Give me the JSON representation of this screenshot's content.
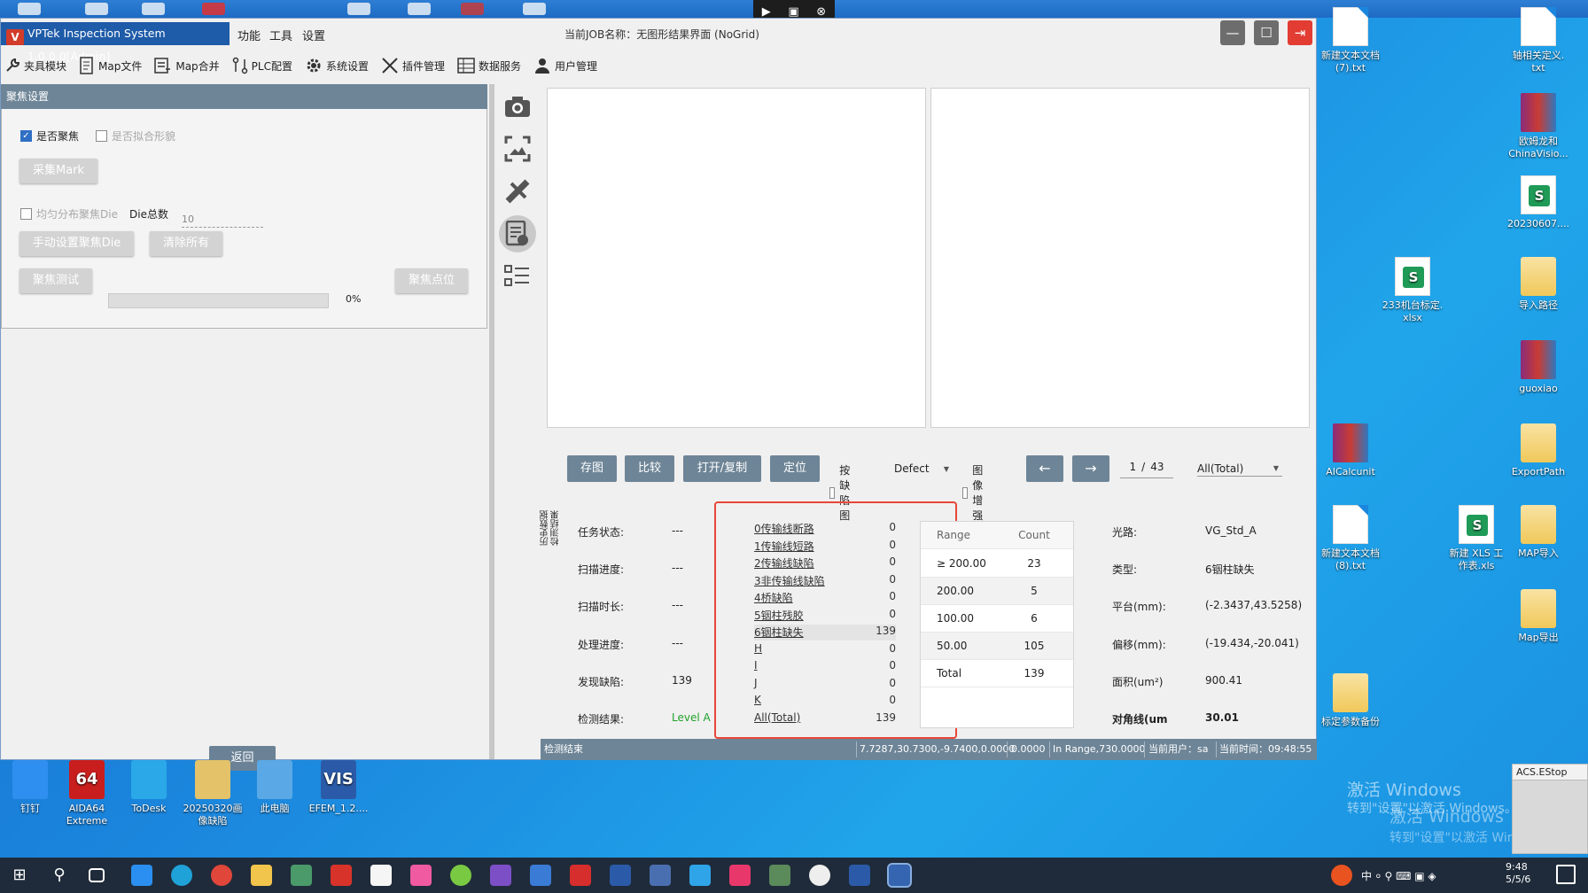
{
  "app": {
    "title": "VPTek Inspection System 1.0.0.0[Admin]",
    "logo_text": "V",
    "menus": [
      "功能",
      "工具",
      "设置"
    ],
    "job_name": "当前JOB名称：无图形结果界面 (NoGrid)",
    "window_buttons": [
      "minimize-icon",
      "maximize-icon",
      "exit-icon"
    ]
  },
  "toolbar": [
    {
      "label": "夹具模块",
      "icon": "wrench-icon"
    },
    {
      "label": "Map文件",
      "icon": "document-icon"
    },
    {
      "label": "Map合并",
      "icon": "merge-icon"
    },
    {
      "label": "PLC配置",
      "icon": "plc-icon"
    },
    {
      "label": "系统设置",
      "icon": "gear-icon"
    },
    {
      "label": "插件管理",
      "icon": "tools-icon"
    },
    {
      "label": "数据服务",
      "icon": "database-icon"
    },
    {
      "label": "用户管理",
      "icon": "user-icon"
    }
  ],
  "focus_panel": {
    "header": "聚焦设置",
    "chk_focus": {
      "label": "是否聚焦",
      "checked": true
    },
    "chk_fit": {
      "label": "是否拟合形貌",
      "checked": false
    },
    "btn_collect_mark": "采集Mark",
    "chk_uniform": {
      "label": "均匀分布聚焦Die",
      "checked": false
    },
    "die_count_label": "Die总数",
    "die_count_value": "10",
    "btn_manual_set": "手动设置聚焦Die",
    "btn_clear_all": "清除所有",
    "btn_focus_test": "聚焦测试",
    "progress_percent": 0,
    "progress_text": "0%",
    "btn_focus_point": "聚焦点位",
    "btn_back": "返回"
  },
  "side_tools": [
    "camera-icon",
    "image-enhance-icon",
    "calibrate-icon",
    "report-icon",
    "checklist-icon"
  ],
  "side_tabs": [
    "检测结果",
    "历史数据"
  ],
  "controls": {
    "btn_save_image": "存图",
    "btn_compare": "比较",
    "btn_open_copy": "打开/复制",
    "btn_locate": "定位",
    "chk_by_defect": {
      "label": "按缺陷图",
      "checked": false
    },
    "defect_select": "Defect",
    "chk_enhance": {
      "label": "图像增强",
      "checked": false
    },
    "btn_prev": "←",
    "btn_next": "→",
    "page_current": "1",
    "page_sep": "/",
    "page_total": "43",
    "filter_select": "All(Total)"
  },
  "status": {
    "task_state_label": "任务状态:",
    "task_state_value": "---",
    "scan_progress_label": "扫描进度:",
    "scan_progress_value": "---",
    "scan_duration_label": "扫描时长:",
    "scan_duration_value": "---",
    "process_progress_label": "处理进度:",
    "process_progress_value": "---",
    "defects_found_label": "发现缺陷:",
    "defects_found_value": "139",
    "result_label": "检测结果:",
    "result_value": "Level A"
  },
  "defect_list": [
    {
      "name": "0传输线断路",
      "count": "0"
    },
    {
      "name": "1传输线短路",
      "count": "0"
    },
    {
      "name": "2传输线缺陷",
      "count": "0"
    },
    {
      "name": "3非传输线缺陷",
      "count": "0"
    },
    {
      "name": "4桥缺陷",
      "count": "0"
    },
    {
      "name": "5铟柱残胶",
      "count": "0"
    },
    {
      "name": "6铟柱缺失",
      "count": "139"
    },
    {
      "name": "H",
      "count": "0"
    },
    {
      "name": "I",
      "count": "0"
    },
    {
      "name": "J",
      "count": "0"
    },
    {
      "name": "K",
      "count": "0"
    },
    {
      "name": "All(Total)",
      "count": "139"
    }
  ],
  "range_table": {
    "headers": [
      "Range",
      "Count"
    ],
    "rows": [
      [
        "≥ 200.00",
        "23"
      ],
      [
        "200.00",
        "5"
      ],
      [
        "100.00",
        "6"
      ],
      [
        "50.00",
        "105"
      ],
      [
        "Total",
        "139"
      ]
    ]
  },
  "info": {
    "light_path_label": "光路:",
    "light_path_value": "VG_Std_A",
    "type_label": "类型:",
    "type_value": "6铟柱缺失",
    "stage_label": "平台(mm):",
    "stage_value": "(-2.3437,43.5258)",
    "offset_label": "偏移(mm):",
    "offset_value": "(-19.434,-20.041)",
    "area_label": "面积(um²)",
    "area_value": "900.41",
    "diagonal_label": "对角线(um",
    "diagonal_value": "30.01"
  },
  "statusbar": {
    "left": "检测结束",
    "coords": "7.7287,30.7300,-9.7400,0.0000",
    "value": "0.0000",
    "in_range": "In Range,730.0000",
    "user": "当前用户：sa",
    "time": "当前时间：09:48:55"
  },
  "desktop_icons": [
    {
      "label": "新建文本文档\n(7).txt",
      "kind": "file"
    },
    {
      "label": "轴相关定义.\ntxt",
      "kind": "file"
    },
    {
      "label": "欧姆龙和\nChinaVisio...",
      "kind": "rar"
    },
    {
      "label": "20230607....",
      "kind": "xls"
    },
    {
      "label": "233机台标定.\nxlsx",
      "kind": "xls"
    },
    {
      "label": "导入路径",
      "kind": "folder"
    },
    {
      "label": "guoxiao",
      "kind": "rar"
    },
    {
      "label": "AICalcunit",
      "kind": "rar"
    },
    {
      "label": "ExportPath",
      "kind": "folder"
    },
    {
      "label": "新建文本文档\n(8).txt",
      "kind": "file"
    },
    {
      "label": "新建 XLS 工\n作表.xls",
      "kind": "xls"
    },
    {
      "label": "MAP导入",
      "kind": "folder"
    },
    {
      "label": "Map导出",
      "kind": "folder"
    },
    {
      "label": "标定参数备份",
      "kind": "folder"
    }
  ],
  "bottom_icons": [
    {
      "label": "钉钉"
    },
    {
      "label": "AIDA64\nExtreme",
      "badge": "64"
    },
    {
      "label": "ToDesk"
    },
    {
      "label": "20250320画\n像缺陷"
    },
    {
      "label": "此电脑"
    },
    {
      "label": "EFEM_1.2....",
      "badge": "VIS"
    }
  ],
  "watermark": {
    "title": "激活 Windows",
    "sub": "转到\"设置\"以激活 Windows。"
  },
  "acs_window": {
    "title": "ACS.EStop"
  },
  "clock": {
    "time": "9:48",
    "date": "5/5/6"
  },
  "colors": {
    "accent": "#6e8597",
    "title_blue": "#1e5ba8",
    "highlight_red": "#e8463a",
    "result_green": "#22a22a"
  }
}
